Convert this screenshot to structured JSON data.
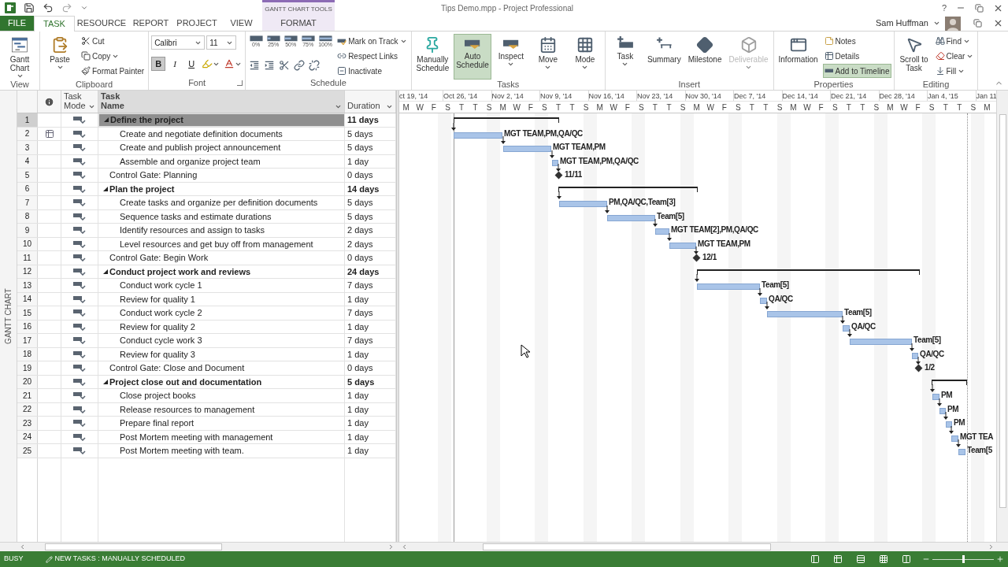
{
  "title_bar": {
    "file_title": "Tips Demo.mpp - Project Professional",
    "context_group": "GANTT CHART TOOLS",
    "help": "?"
  },
  "tabs": [
    {
      "label": "FILE",
      "kind": "file",
      "selected": false
    },
    {
      "label": "TASK",
      "kind": "tab",
      "selected": true
    },
    {
      "label": "RESOURCE",
      "kind": "tab",
      "selected": false
    },
    {
      "label": "REPORT",
      "kind": "tab",
      "selected": false
    },
    {
      "label": "PROJECT",
      "kind": "tab",
      "selected": false
    },
    {
      "label": "VIEW",
      "kind": "tab",
      "selected": false
    },
    {
      "label": "FORMAT",
      "kind": "context",
      "selected": false
    }
  ],
  "user": {
    "name": "Sam Huffman"
  },
  "ribbon": [
    {
      "label": "View",
      "items": [
        {
          "kind": "large",
          "label": "Gantt Chart",
          "dropdown": true
        }
      ]
    },
    {
      "label": "Clipboard",
      "items": [
        {
          "kind": "large",
          "label": "Paste",
          "dropdown": true
        },
        {
          "kind": "small",
          "label": "Cut",
          "dropdown": false
        },
        {
          "kind": "small",
          "label": "Copy",
          "dropdown": true
        },
        {
          "kind": "small",
          "label": "Format Painter",
          "dropdown": false
        }
      ]
    },
    {
      "label": "Font",
      "launcher": true,
      "items": [
        {
          "kind": "combo",
          "label": "Calibri",
          "dropdown": true
        },
        {
          "kind": "combo",
          "label": "11",
          "dropdown": true
        },
        {
          "kind": "toggle",
          "label": "B",
          "on": true
        },
        {
          "kind": "toggle",
          "label": "I",
          "on": false
        },
        {
          "kind": "toggle",
          "label": "U",
          "on": false
        },
        {
          "kind": "icon",
          "dropdown": true
        },
        {
          "kind": "icon",
          "dropdown": true
        }
      ]
    },
    {
      "label": "Schedule",
      "items": [
        {
          "kind": "percent",
          "label": "0%"
        },
        {
          "kind": "percent",
          "label": "25%"
        },
        {
          "kind": "percent",
          "label": "50%"
        },
        {
          "kind": "percent",
          "label": "75%"
        },
        {
          "kind": "percent",
          "label": "100%"
        },
        {
          "kind": "icon",
          "dropdown": false
        },
        {
          "kind": "icon",
          "dropdown": false
        },
        {
          "kind": "icon",
          "dropdown": false
        },
        {
          "kind": "icon",
          "dropdown": false
        },
        {
          "kind": "icon",
          "dropdown": false
        },
        {
          "kind": "small",
          "label": "Mark on Track",
          "dropdown": true
        },
        {
          "kind": "small",
          "label": "Respect Links",
          "dropdown": false
        },
        {
          "kind": "small",
          "label": "Inactivate",
          "dropdown": false
        }
      ]
    },
    {
      "label": "Tasks",
      "items": [
        {
          "kind": "large",
          "label": "Manually Schedule",
          "dropdown": false,
          "on": false
        },
        {
          "kind": "large",
          "label": "Auto Schedule",
          "dropdown": false,
          "on": true
        },
        {
          "kind": "large",
          "label": "Inspect",
          "dropdown": true
        },
        {
          "kind": "large",
          "label": "Move",
          "dropdown": true
        },
        {
          "kind": "large",
          "label": "Mode",
          "dropdown": true
        }
      ]
    },
    {
      "label": "Insert",
      "items": [
        {
          "kind": "large",
          "label": "Task",
          "dropdown": true,
          "disabled": false
        },
        {
          "kind": "large",
          "label": "Summary",
          "dropdown": false,
          "disabled": false
        },
        {
          "kind": "large",
          "label": "Milestone",
          "dropdown": false,
          "disabled": false
        },
        {
          "kind": "large",
          "label": "Deliverable",
          "dropdown": true,
          "disabled": true
        }
      ]
    },
    {
      "label": "Properties",
      "items": [
        {
          "kind": "large",
          "label": "Information",
          "dropdown": false
        },
        {
          "kind": "small",
          "label": "Notes",
          "dropdown": false
        },
        {
          "kind": "small",
          "label": "Details",
          "dropdown": false
        },
        {
          "kind": "small",
          "label": "Add to Timeline",
          "dropdown": false,
          "on": true
        }
      ]
    },
    {
      "label": "Editing",
      "items": [
        {
          "kind": "large",
          "label": "Scroll to Task",
          "dropdown": false
        },
        {
          "kind": "small",
          "label": "Find",
          "dropdown": true
        },
        {
          "kind": "small",
          "label": "Clear",
          "dropdown": true
        },
        {
          "kind": "small",
          "label": "Fill",
          "dropdown": true
        }
      ]
    }
  ],
  "view_bar": {
    "label": "GANTT CHART"
  },
  "table": {
    "columns": [
      {
        "label": "Task Mode",
        "filter": true,
        "selected": false
      },
      {
        "label": "Task Name",
        "filter": true,
        "selected": true
      },
      {
        "label": "Duration",
        "filter": true,
        "selected": false
      }
    ],
    "tasks": [
      {
        "id": "1",
        "name": "Define the project",
        "duration": "11 days",
        "kind": "summary",
        "expanded": true,
        "selected": true,
        "indicator": false,
        "children": [
          {
            "id": "2",
            "name": "Create and negotiate definition documents",
            "duration": "5 days",
            "kind": "task",
            "bar_label": "MGT TEAM,PM,QA/QC",
            "selected": false,
            "indicator": true
          },
          {
            "id": "3",
            "name": "Create and publish project announcement",
            "duration": "5 days",
            "kind": "task",
            "bar_label": "MGT TEAM,PM",
            "selected": false,
            "indicator": false
          },
          {
            "id": "4",
            "name": "Assemble and organize project team",
            "duration": "1 day",
            "kind": "task",
            "bar_label": "MGT TEAM,PM,QA/QC",
            "selected": false,
            "indicator": false
          }
        ]
      },
      {
        "id": "5",
        "name": "Control Gate: Planning",
        "duration": "0 days",
        "kind": "milestone",
        "bar_label": "11/11",
        "selected": false,
        "indicator": false
      },
      {
        "id": "6",
        "name": "Plan the project",
        "duration": "14 days",
        "kind": "summary",
        "expanded": true,
        "selected": false,
        "indicator": false,
        "children": [
          {
            "id": "7",
            "name": "Create tasks and organize per definition documents",
            "duration": "5 days",
            "kind": "task",
            "bar_label": "PM,QA/QC,Team[3]",
            "selected": false,
            "indicator": false
          },
          {
            "id": "8",
            "name": "Sequence tasks and estimate durations",
            "duration": "5 days",
            "kind": "task",
            "bar_label": "Team[5]",
            "selected": false,
            "indicator": false
          },
          {
            "id": "9",
            "name": "Identify resources and assign to tasks",
            "duration": "2 days",
            "kind": "task",
            "bar_label": "MGT TEAM[2],PM,QA/QC",
            "selected": false,
            "indicator": false
          },
          {
            "id": "10",
            "name": "Level resources and get buy off from management",
            "duration": "2 days",
            "kind": "task",
            "bar_label": "MGT TEAM,PM",
            "selected": false,
            "indicator": false
          }
        ]
      },
      {
        "id": "11",
        "name": "Control Gate: Begin Work",
        "duration": "0 days",
        "kind": "milestone",
        "bar_label": "12/1",
        "selected": false,
        "indicator": false
      },
      {
        "id": "12",
        "name": "Conduct project work and reviews",
        "duration": "24 days",
        "kind": "summary",
        "expanded": true,
        "selected": false,
        "indicator": false,
        "children": [
          {
            "id": "13",
            "name": "Conduct work cycle 1",
            "duration": "7 days",
            "kind": "task",
            "bar_label": "Team[5]",
            "selected": false,
            "indicator": false
          },
          {
            "id": "14",
            "name": "Review for quality 1",
            "duration": "1 day",
            "kind": "task",
            "bar_label": "QA/QC",
            "selected": false,
            "indicator": false
          },
          {
            "id": "15",
            "name": "Conduct work cycle 2",
            "duration": "7 days",
            "kind": "task",
            "bar_label": "Team[5]",
            "selected": false,
            "indicator": false
          },
          {
            "id": "16",
            "name": "Review for quality 2",
            "duration": "1 day",
            "kind": "task",
            "bar_label": "QA/QC",
            "selected": false,
            "indicator": false
          },
          {
            "id": "17",
            "name": "Conduct cycle work 3",
            "duration": "7 days",
            "kind": "task",
            "bar_label": "Team[5]",
            "selected": false,
            "indicator": false
          },
          {
            "id": "18",
            "name": "Review for quality 3",
            "duration": "1 day",
            "kind": "task",
            "bar_label": "QA/QC",
            "selected": false,
            "indicator": false
          }
        ]
      },
      {
        "id": "19",
        "name": "Control Gate: Close and Document",
        "duration": "0 days",
        "kind": "milestone",
        "bar_label": "1/2",
        "selected": false,
        "indicator": false
      },
      {
        "id": "20",
        "name": "Project close out and documentation",
        "duration": "5 days",
        "kind": "summary",
        "expanded": true,
        "selected": false,
        "indicator": false,
        "children": [
          {
            "id": "21",
            "name": "Close project books",
            "duration": "1 day",
            "kind": "task",
            "bar_label": "PM",
            "selected": false,
            "indicator": false
          },
          {
            "id": "22",
            "name": "Release resources to management",
            "duration": "1 day",
            "kind": "task",
            "bar_label": "PM",
            "selected": false,
            "indicator": false
          },
          {
            "id": "23",
            "name": "Prepare final report",
            "duration": "1 day",
            "kind": "task",
            "bar_label": "PM",
            "selected": false,
            "indicator": false
          },
          {
            "id": "24",
            "name": "Post Mortem meeting with management",
            "duration": "1 day",
            "kind": "task",
            "bar_label": "MGT TEA",
            "selected": false,
            "indicator": false
          },
          {
            "id": "25",
            "name": "Post Mortem meeting with team.",
            "duration": "1 day",
            "kind": "task",
            "bar_label": "Team[5",
            "selected": false,
            "indicator": false
          }
        ]
      }
    ]
  },
  "timescale": {
    "weeks": [
      "ct 19, '14",
      "Oct 26, '14",
      "Nov 2, '14",
      "Nov 9, '14",
      "Nov 16, '14",
      "Nov 23, '14",
      "Nov 30, '14",
      "Dec 7, '14",
      "Dec 14, '14",
      "Dec 21, '14",
      "Dec 28, '14",
      "Jan 4, '15",
      "Jan 11"
    ],
    "days": [
      "M",
      "W",
      "F",
      "S",
      "T",
      "T",
      "S",
      "M",
      "W",
      "F",
      "S",
      "T",
      "T",
      "S",
      "M",
      "W",
      "F",
      "S",
      "T",
      "T",
      "S",
      "M",
      "W",
      "F",
      "S",
      "T",
      "T",
      "S",
      "M",
      "W",
      "F",
      "S",
      "T",
      "T",
      "S",
      "M",
      "W",
      "F",
      "S",
      "T",
      "T",
      "S",
      "M"
    ]
  },
  "status_bar": {
    "mode": "BUSY",
    "new_tasks": "NEW TASKS : MANUALLY SCHEDULED",
    "zoom": {
      "level": 0.5
    }
  }
}
